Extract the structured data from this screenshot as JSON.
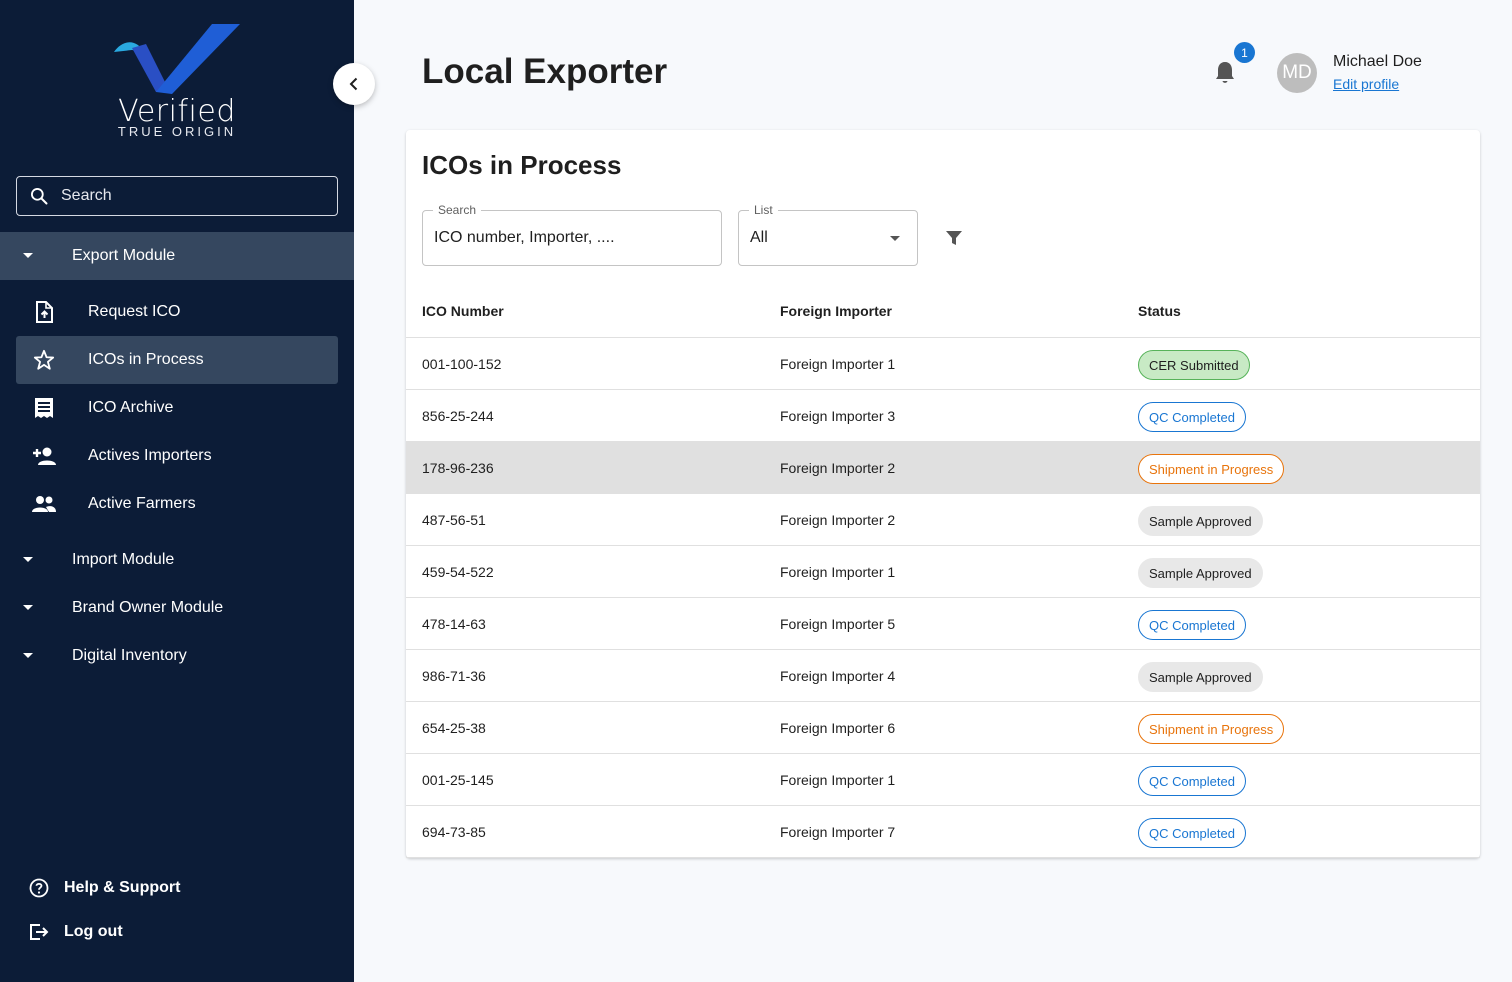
{
  "brand": {
    "name": "Verified",
    "tagline": "TRUE ORIGIN",
    "colors": {
      "primary": "#1f5ed6",
      "accent": "#2aa9e0"
    }
  },
  "sidebar": {
    "search_placeholder": "Search",
    "modules": [
      {
        "label": "Export Module",
        "expanded": true
      },
      {
        "label": "Import Module",
        "expanded": false
      },
      {
        "label": "Brand Owner Module",
        "expanded": false
      },
      {
        "label": "Digital Inventory",
        "expanded": false
      }
    ],
    "export_items": [
      {
        "label": "Request ICO",
        "icon": "file-upload-icon"
      },
      {
        "label": "ICOs in Process",
        "icon": "star-icon",
        "selected": true
      },
      {
        "label": "ICO Archive",
        "icon": "receipt-icon"
      },
      {
        "label": "Actives Importers",
        "icon": "person-add-icon"
      },
      {
        "label": "Active Farmers",
        "icon": "people-icon"
      }
    ],
    "help_label": "Help & Support",
    "logout_label": "Log out"
  },
  "header": {
    "title": "Local Exporter",
    "notification_count": "1",
    "user_initials": "MD",
    "user_name": "Michael Doe",
    "edit_profile_label": "Edit profile"
  },
  "card": {
    "title": "ICOs in Process",
    "search": {
      "label": "Search",
      "value": "ICO number, Importer, ...."
    },
    "list": {
      "label": "List",
      "value": "All"
    }
  },
  "table": {
    "columns": [
      "ICO Number",
      "Foreign Importer",
      "Status"
    ],
    "rows": [
      {
        "ico": "001-100-152",
        "importer": "Foreign Importer 1",
        "status": "CER Submitted"
      },
      {
        "ico": "856-25-244",
        "importer": "Foreign Importer 3",
        "status": "QC Completed"
      },
      {
        "ico": "178-96-236",
        "importer": "Foreign Importer 2",
        "status": "Shipment in Progress"
      },
      {
        "ico": "487-56-51",
        "importer": "Foreign Importer 2",
        "status": "Sample Approved"
      },
      {
        "ico": "459-54-522",
        "importer": "Foreign Importer 1",
        "status": "Sample Approved"
      },
      {
        "ico": "478-14-63",
        "importer": "Foreign Importer 5",
        "status": "QC Completed"
      },
      {
        "ico": "986-71-36",
        "importer": "Foreign Importer 4",
        "status": "Sample Approved"
      },
      {
        "ico": "654-25-38",
        "importer": "Foreign Importer 6",
        "status": "Shipment in Progress"
      },
      {
        "ico": "001-25-145",
        "importer": "Foreign Importer 1",
        "status": "QC Completed"
      },
      {
        "ico": "694-73-85",
        "importer": "Foreign Importer 7",
        "status": "QC Completed"
      }
    ]
  },
  "status_colors": {
    "CER Submitted": "#57b35a",
    "QC Completed": "#1976d2",
    "Shipment in Progress": "#e8740c",
    "Sample Approved": "#e8e8e8"
  }
}
